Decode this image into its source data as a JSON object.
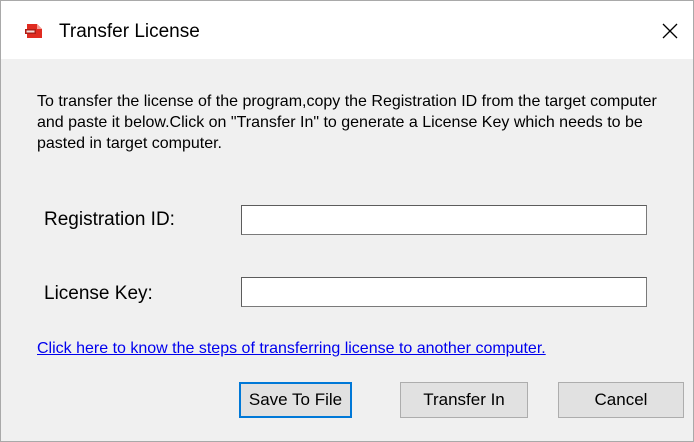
{
  "window": {
    "title": "Transfer License",
    "icon": "pdf-app-icon",
    "close_icon": "close-icon"
  },
  "description": "To transfer the license of the program,copy the Registration ID from the target computer and paste it below.Click on \"Transfer In\" to generate a License Key which needs to be pasted in target computer.",
  "fields": {
    "registration_id": {
      "label": "Registration ID:",
      "value": ""
    },
    "license_key": {
      "label": "License Key:",
      "value": ""
    }
  },
  "help_link": "Click here to know the steps of transferring license to another computer.",
  "buttons": {
    "save": "Save To File",
    "transfer": "Transfer In",
    "cancel": "Cancel"
  },
  "colors": {
    "link": "#0000ee",
    "focus_border": "#0078d7",
    "icon_red": "#e02b20",
    "background": "#f0f0f0"
  }
}
